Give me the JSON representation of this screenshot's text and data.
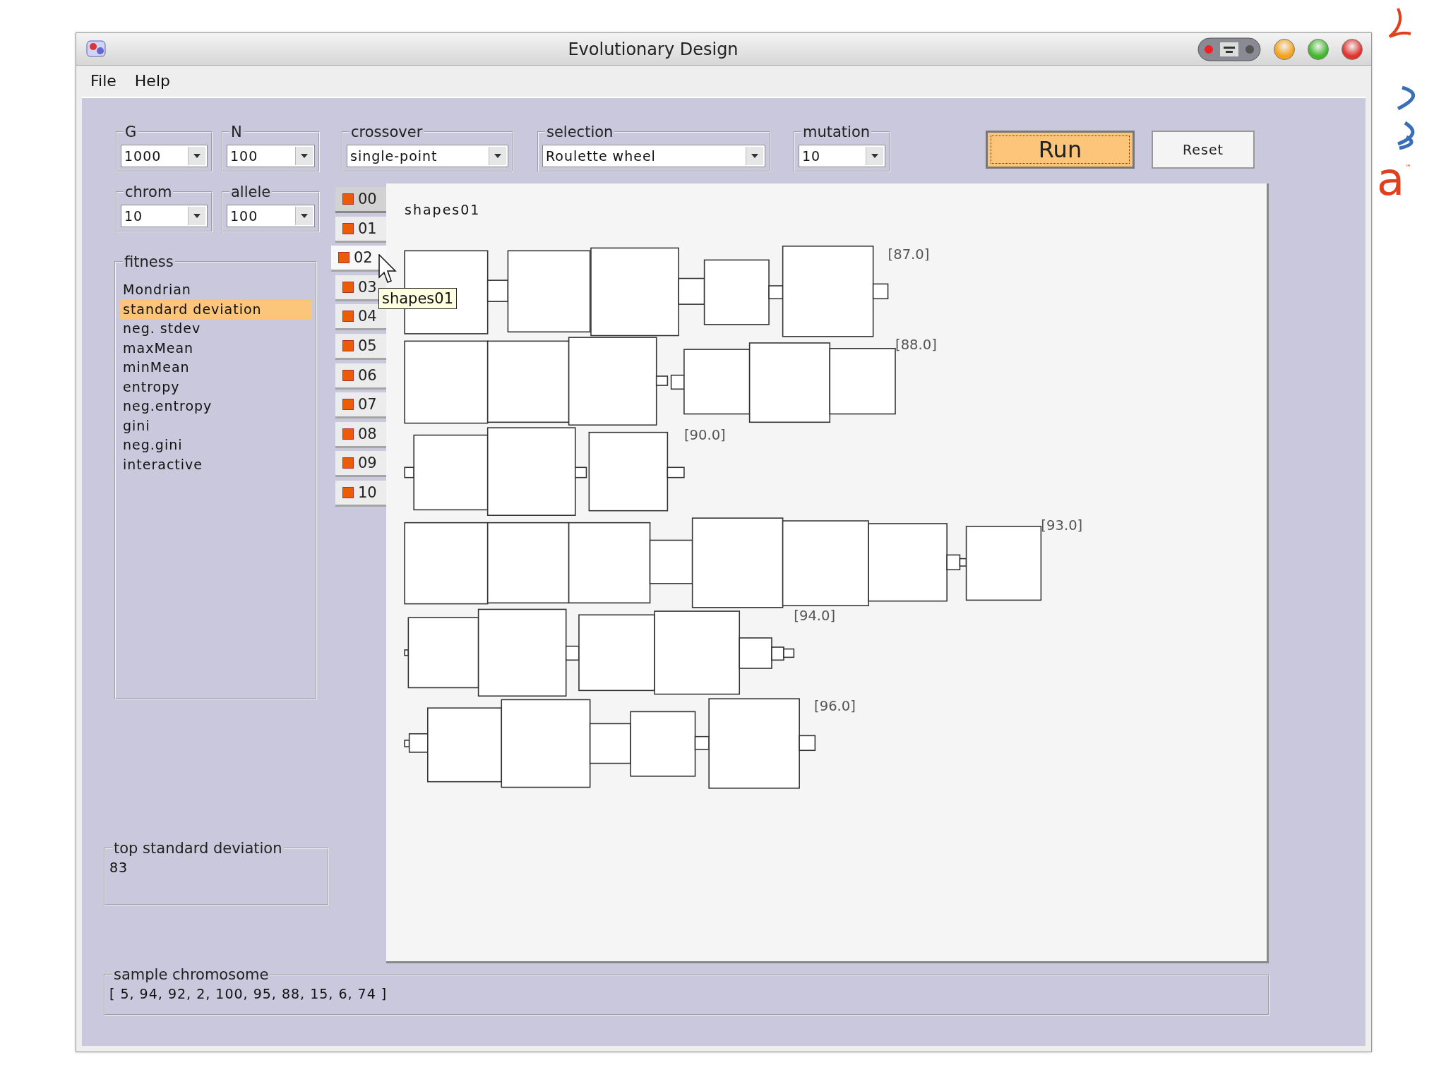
{
  "window": {
    "title": "Evolutionary Design"
  },
  "menu": [
    "File",
    "Help"
  ],
  "parameters": [
    {
      "label": "G",
      "value": "1000"
    },
    {
      "label": "N",
      "value": "100"
    },
    {
      "label": "crossover",
      "value": "single-point"
    },
    {
      "label": "selection",
      "value": "Roulette wheel"
    },
    {
      "label": "mutation",
      "value": "10"
    }
  ],
  "parameters_row2": [
    {
      "label": "chrom",
      "value": "10"
    },
    {
      "label": "allele",
      "value": "100"
    }
  ],
  "buttons": [
    {
      "label": "Run",
      "kind": "primary"
    },
    {
      "label": "Reset",
      "kind": "plain"
    }
  ],
  "fitness": {
    "label": "fitness",
    "items": [
      {
        "label": "Mondrian",
        "selected": false
      },
      {
        "label": "standard deviation",
        "selected": true
      },
      {
        "label": "neg. stdev",
        "selected": false
      },
      {
        "label": "maxMean",
        "selected": false
      },
      {
        "label": "minMean",
        "selected": false
      },
      {
        "label": "entropy",
        "selected": false
      },
      {
        "label": "neg.entropy",
        "selected": false
      },
      {
        "label": "gini",
        "selected": false
      },
      {
        "label": "neg.gini",
        "selected": false
      },
      {
        "label": "interactive",
        "selected": false
      }
    ]
  },
  "tabs": [
    {
      "label": "00",
      "selected": true,
      "hovered": false
    },
    {
      "label": "01",
      "selected": false,
      "hovered": false
    },
    {
      "label": "02",
      "selected": false,
      "hovered": true
    },
    {
      "label": "03",
      "selected": false,
      "hovered": false
    },
    {
      "label": "04",
      "selected": false,
      "hovered": false
    },
    {
      "label": "05",
      "selected": false,
      "hovered": false
    },
    {
      "label": "06",
      "selected": false,
      "hovered": false
    },
    {
      "label": "07",
      "selected": false,
      "hovered": false
    },
    {
      "label": "08",
      "selected": false,
      "hovered": false
    },
    {
      "label": "09",
      "selected": false,
      "hovered": false
    },
    {
      "label": "10",
      "selected": false,
      "hovered": false
    }
  ],
  "tooltip": {
    "text": "shapes01"
  },
  "canvas": {
    "title": "shapes01",
    "designs": [
      {
        "label": "[87.0]"
      },
      {
        "label": "[88.0]"
      },
      {
        "label": "[90.0]"
      },
      {
        "label": "[93.0]"
      },
      {
        "label": "[94.0]"
      },
      {
        "label": "[96.0]"
      }
    ]
  },
  "top_result": {
    "label": "top standard deviation",
    "value": "83"
  },
  "sample": {
    "label": "sample chromosome",
    "value": "[ 5, 94, 92, 2, 100, 95, 88, 15, 6, 74 ]"
  },
  "desktop": {
    "logo_text": "a",
    "logo_mark": "™"
  }
}
